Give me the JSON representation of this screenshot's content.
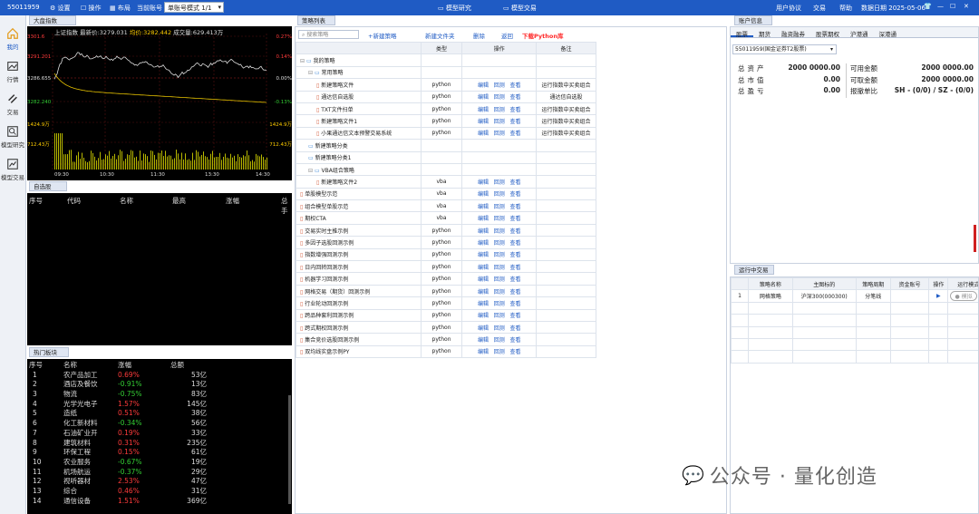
{
  "topbar": {
    "account_id": "55011959",
    "settings": "设置",
    "operate": "操作",
    "layout": "布局",
    "current_account_label": "当前账号",
    "mode_select": "单账号模式 1/1",
    "center_tab1": "模型研究",
    "center_tab2": "模型交易",
    "user_agreement": "用户协议",
    "trade": "交易",
    "help": "帮助",
    "date_label": "数据日期",
    "date_value": "2025-05-06"
  },
  "nav": [
    {
      "label": "我的"
    },
    {
      "label": "行情"
    },
    {
      "label": "交易"
    },
    {
      "label": "模型研究"
    },
    {
      "label": "模型交易"
    }
  ],
  "market": {
    "panel_title": "大盘指数",
    "index_name": "上证指数",
    "latest_label": "最新价:",
    "latest": "3279.031",
    "avg_label": "均价:",
    "avg": "3282.442",
    "vol_label": "成交量:",
    "vol": "629.413万",
    "y_left": [
      "3301.6",
      "3291.201",
      "3286.655",
      "3282.240",
      "1424.9万",
      "712.43万"
    ],
    "y_right": [
      "0.27%",
      "0.14%",
      "0.00%",
      "-0.13%",
      "1424.9万",
      "712.43万"
    ],
    "x_ticks": [
      "09:30",
      "10:30",
      "11:30",
      "13:30",
      "14:30"
    ]
  },
  "watchlist": {
    "panel_title": "自选股",
    "cols": [
      "序号",
      "代码",
      "名称",
      "最高",
      "涨幅",
      "总手"
    ]
  },
  "hot": {
    "panel_title": "热门板块",
    "cols": [
      "序号",
      "名称",
      "涨幅",
      "总额"
    ],
    "rows": [
      {
        "no": "1",
        "name": "农产品加工",
        "chg": "0.69%",
        "amt": "53亿",
        "up": true
      },
      {
        "no": "2",
        "name": "酒店及餐饮",
        "chg": "-0.91%",
        "amt": "13亿",
        "up": false
      },
      {
        "no": "3",
        "name": "物流",
        "chg": "-0.75%",
        "amt": "83亿",
        "up": false
      },
      {
        "no": "4",
        "name": "光学光电子",
        "chg": "1.57%",
        "amt": "145亿",
        "up": true
      },
      {
        "no": "5",
        "name": "造纸",
        "chg": "0.51%",
        "amt": "38亿",
        "up": true
      },
      {
        "no": "6",
        "name": "化工新材料",
        "chg": "-0.34%",
        "amt": "56亿",
        "up": false
      },
      {
        "no": "7",
        "name": "石油矿业开",
        "chg": "0.19%",
        "amt": "33亿",
        "up": true
      },
      {
        "no": "8",
        "name": "建筑材料",
        "chg": "0.31%",
        "amt": "235亿",
        "up": true
      },
      {
        "no": "9",
        "name": "环保工程",
        "chg": "0.15%",
        "amt": "61亿",
        "up": true
      },
      {
        "no": "10",
        "name": "农业服务",
        "chg": "-0.67%",
        "amt": "19亿",
        "up": false
      },
      {
        "no": "11",
        "name": "机场航运",
        "chg": "-0.37%",
        "amt": "29亿",
        "up": false
      },
      {
        "no": "12",
        "name": "视听器材",
        "chg": "2.53%",
        "amt": "47亿",
        "up": true
      },
      {
        "no": "13",
        "name": "综合",
        "chg": "0.46%",
        "amt": "31亿",
        "up": true
      },
      {
        "no": "14",
        "name": "通信设备",
        "chg": "1.51%",
        "amt": "369亿",
        "up": true
      }
    ]
  },
  "strategy": {
    "panel_title": "策略列表",
    "search_placeholder": "搜索策略",
    "new_strategy": "+新建策略",
    "new_folder": "新建文件夹",
    "delete": "删除",
    "back": "返回",
    "download": "下载Python库",
    "cols": [
      "",
      "类型",
      "操作",
      "备注"
    ],
    "op_edit": "编辑",
    "op_backtest": "回测",
    "op_view": "查看",
    "rows": [
      {
        "name": "我的策略",
        "type": "",
        "ops": false,
        "note": "",
        "lvl": 0,
        "kind": "folder",
        "ex": "⊟"
      },
      {
        "name": "常用策略",
        "type": "",
        "ops": false,
        "note": "",
        "lvl": 1,
        "kind": "folder",
        "ex": "⊟"
      },
      {
        "name": "新建策略文件",
        "type": "python",
        "ops": true,
        "note": "运行指数中买卖组合",
        "lvl": 2,
        "kind": "file",
        "ex": ""
      },
      {
        "name": "通达信自选股",
        "type": "python",
        "ops": true,
        "note": "通达信自选股",
        "lvl": 2,
        "kind": "file",
        "ex": ""
      },
      {
        "name": "TXT文件扫单",
        "type": "python",
        "ops": true,
        "note": "运行指数中买卖组合",
        "lvl": 2,
        "kind": "file",
        "ex": ""
      },
      {
        "name": "新建策略文件1",
        "type": "python",
        "ops": true,
        "note": "运行指数中买卖组合",
        "lvl": 2,
        "kind": "file",
        "ex": ""
      },
      {
        "name": "小果通达信文本预警交易系统",
        "type": "python",
        "ops": true,
        "note": "运行指数中买卖组合",
        "lvl": 2,
        "kind": "file",
        "ex": ""
      },
      {
        "name": "新建策略分类",
        "type": "",
        "ops": false,
        "note": "",
        "lvl": 1,
        "kind": "folder",
        "ex": ""
      },
      {
        "name": "新建策略分类1",
        "type": "",
        "ops": false,
        "note": "",
        "lvl": 1,
        "kind": "folder",
        "ex": ""
      },
      {
        "name": "VBA组合策略",
        "type": "",
        "ops": false,
        "note": "",
        "lvl": 1,
        "kind": "folder",
        "ex": "⊟"
      },
      {
        "name": "新建策略文件2",
        "type": "vba",
        "ops": true,
        "note": "",
        "lvl": 2,
        "kind": "file",
        "ex": ""
      },
      {
        "name": "单股模型示范",
        "type": "vba",
        "ops": true,
        "note": "",
        "lvl": 0,
        "kind": "file",
        "ex": ""
      },
      {
        "name": "组合模型单股示范",
        "type": "vba",
        "ops": true,
        "note": "",
        "lvl": 0,
        "kind": "file",
        "ex": ""
      },
      {
        "name": "期权CTA",
        "type": "vba",
        "ops": true,
        "note": "",
        "lvl": 0,
        "kind": "file",
        "ex": ""
      },
      {
        "name": "交易实时主推示例",
        "type": "python",
        "ops": true,
        "note": "",
        "lvl": 0,
        "kind": "file",
        "ex": ""
      },
      {
        "name": "多因子选股回测示例",
        "type": "python",
        "ops": true,
        "note": "",
        "lvl": 0,
        "kind": "file",
        "ex": ""
      },
      {
        "name": "指数增强回测示例",
        "type": "python",
        "ops": true,
        "note": "",
        "lvl": 0,
        "kind": "file",
        "ex": ""
      },
      {
        "name": "日内回转回测示例",
        "type": "python",
        "ops": true,
        "note": "",
        "lvl": 0,
        "kind": "file",
        "ex": ""
      },
      {
        "name": "机器学习回测示例",
        "type": "python",
        "ops": true,
        "note": "",
        "lvl": 0,
        "kind": "file",
        "ex": ""
      },
      {
        "name": "网格交易（期货）回测示例",
        "type": "python",
        "ops": true,
        "note": "",
        "lvl": 0,
        "kind": "file",
        "ex": ""
      },
      {
        "name": "行业轮动回测示例",
        "type": "python",
        "ops": true,
        "note": "",
        "lvl": 0,
        "kind": "file",
        "ex": ""
      },
      {
        "name": "跨品种套利回测示例",
        "type": "python",
        "ops": true,
        "note": "",
        "lvl": 0,
        "kind": "file",
        "ex": ""
      },
      {
        "name": "跨式期权回测示例",
        "type": "python",
        "ops": true,
        "note": "",
        "lvl": 0,
        "kind": "file",
        "ex": ""
      },
      {
        "name": "集合竞价选股回测示例",
        "type": "python",
        "ops": true,
        "note": "",
        "lvl": 0,
        "kind": "file",
        "ex": ""
      },
      {
        "name": "双均线实盘示例PY",
        "type": "python",
        "ops": true,
        "note": "",
        "lvl": 0,
        "kind": "file",
        "ex": ""
      }
    ]
  },
  "account": {
    "panel_title": "账户信息",
    "tabs": [
      "股票",
      "期货",
      "融资融券",
      "股票期权",
      "沪港通",
      "深港通"
    ],
    "select": "55011959(国金证券T2股票)",
    "rows": [
      {
        "l": "总资产",
        "v": "2000 0000.00",
        "l2": "可用金额",
        "v2": "2000 0000.00"
      },
      {
        "l": "总市值",
        "v": "0.00",
        "l2": "可取金额",
        "v2": "2000 0000.00"
      },
      {
        "l": "总盈亏",
        "v": "0.00",
        "l2": "报撤单比",
        "v2": "SH - (0/0) / SZ - (0/0)"
      }
    ]
  },
  "running": {
    "panel_title": "运行中交易",
    "cols": [
      "",
      "策略名称",
      "主图标的",
      "策略周期",
      "资金账号",
      "操作",
      "运行模式"
    ],
    "row": {
      "no": "1",
      "name": "网格策略",
      "target": "沪深300(000300)",
      "period": "分笔线",
      "acct": "",
      "mode": "模拟"
    }
  },
  "watermark": "公众号 · 量化创造",
  "colors": {
    "brand": "#1f5bc4",
    "up": "#ff3b3b",
    "down": "#33cc33"
  }
}
